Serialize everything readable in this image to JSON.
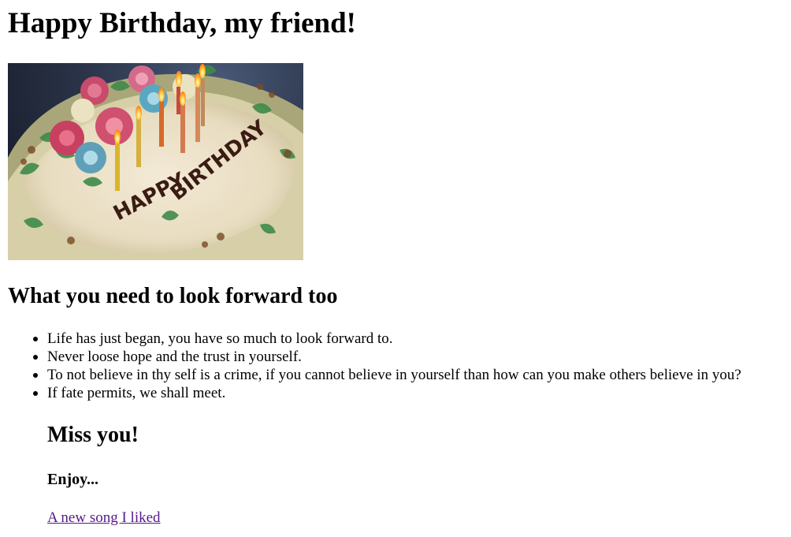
{
  "page": {
    "title": "Happy Birthday, my friend!",
    "section_heading": "What you need to look forward too",
    "wishes": [
      "Life has just began, you have so much to look forward to.",
      "Never loose hope and the trust in yourself.",
      "To not believe in thy self is a crime, if you cannot believe in yourself than how can you make others believe in you?",
      "If fate permits, we shall meet."
    ],
    "miss_heading": "Miss you!",
    "enjoy_heading": "Enjoy...",
    "song_link": "A new song I liked"
  },
  "image": {
    "subject": "birthday-cake-with-candles",
    "cake_text": "HAPPY BIRTHDAY"
  },
  "colors": {
    "link_visited": "#551a8b",
    "text": "#000000",
    "background": "#ffffff"
  }
}
